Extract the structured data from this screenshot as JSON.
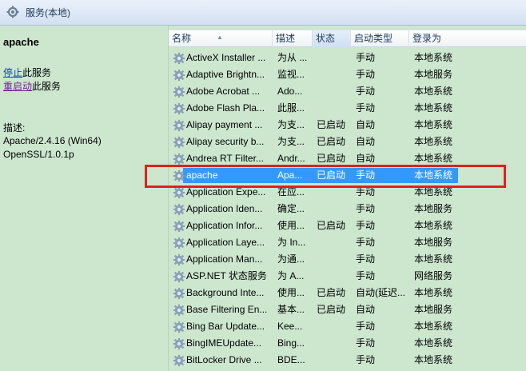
{
  "window": {
    "title": "服务(本地)"
  },
  "left_pane": {
    "service_name": "apache",
    "stop_link": "停止",
    "stop_suffix": "此服务",
    "restart_link": "重启动",
    "restart_suffix": "此服务",
    "description_label": "描述:",
    "description_text": "Apache/2.4.16 (Win64)\nOpenSSL/1.0.1p"
  },
  "columns": {
    "name": "名称",
    "description": "描述",
    "status": "状态",
    "startup_type": "启动类型",
    "logon_as": "登录为"
  },
  "sorted_column": "名称",
  "selected_service": "apache",
  "services": [
    {
      "name": "ActiveX Installer ...",
      "description": "为从 ...",
      "status": "",
      "startup": "手动",
      "logon": "本地系统"
    },
    {
      "name": "Adaptive Brightn...",
      "description": "监视...",
      "status": "",
      "startup": "手动",
      "logon": "本地服务"
    },
    {
      "name": "Adobe Acrobat ...",
      "description": "Ado...",
      "status": "",
      "startup": "手动",
      "logon": "本地系统"
    },
    {
      "name": "Adobe Flash Pla...",
      "description": "此服...",
      "status": "",
      "startup": "手动",
      "logon": "本地系统"
    },
    {
      "name": "Alipay payment ...",
      "description": "为支...",
      "status": "已启动",
      "startup": "自动",
      "logon": "本地系统"
    },
    {
      "name": "Alipay security b...",
      "description": "为支...",
      "status": "已启动",
      "startup": "自动",
      "logon": "本地系统"
    },
    {
      "name": "Andrea RT Filter...",
      "description": "Andr...",
      "status": "已启动",
      "startup": "自动",
      "logon": "本地系统"
    },
    {
      "name": "apache",
      "description": "Apa...",
      "status": "已启动",
      "startup": "手动",
      "logon": "本地系统"
    },
    {
      "name": "Application Expe...",
      "description": "在应...",
      "status": "",
      "startup": "手动",
      "logon": "本地系统"
    },
    {
      "name": "Application Iden...",
      "description": "确定...",
      "status": "",
      "startup": "手动",
      "logon": "本地服务"
    },
    {
      "name": "Application Infor...",
      "description": "使用...",
      "status": "已启动",
      "startup": "手动",
      "logon": "本地系统"
    },
    {
      "name": "Application Laye...",
      "description": "为 In...",
      "status": "",
      "startup": "手动",
      "logon": "本地服务"
    },
    {
      "name": "Application Man...",
      "description": "为通...",
      "status": "",
      "startup": "手动",
      "logon": "本地系统"
    },
    {
      "name": "ASP.NET 状态服务",
      "description": "为 A...",
      "status": "",
      "startup": "手动",
      "logon": "网络服务"
    },
    {
      "name": "Background Inte...",
      "description": "使用...",
      "status": "已启动",
      "startup": "自动(延迟...",
      "logon": "本地系统"
    },
    {
      "name": "Base Filtering En...",
      "description": "基本...",
      "status": "已启动",
      "startup": "自动",
      "logon": "本地服务"
    },
    {
      "name": "Bing Bar Update...",
      "description": "Kee...",
      "status": "",
      "startup": "手动",
      "logon": "本地系统"
    },
    {
      "name": "BingIMEUpdate...",
      "description": "Bing...",
      "status": "",
      "startup": "手动",
      "logon": "本地系统"
    },
    {
      "name": "BitLocker Drive ...",
      "description": "BDE...",
      "status": "",
      "startup": "手动",
      "logon": "本地系统"
    }
  ],
  "colors": {
    "background": "#cde7cf",
    "selection": "#3399ff",
    "highlight_border": "#e0201e",
    "link": "#0645ad"
  },
  "icons": {
    "service": "gear-icon",
    "title": "services-icon"
  }
}
